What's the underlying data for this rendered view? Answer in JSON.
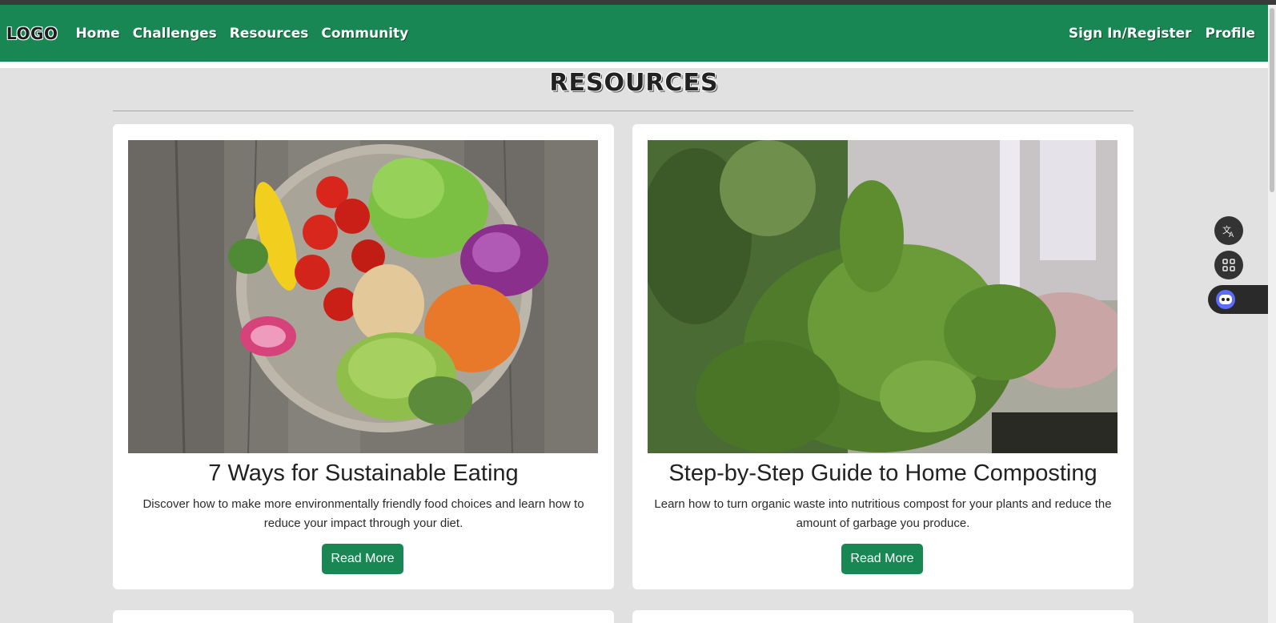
{
  "navbar": {
    "logo": "LOGO",
    "links": [
      "Home",
      "Challenges",
      "Resources",
      "Community"
    ],
    "right_links": [
      "Sign In/Register",
      "Profile"
    ]
  },
  "page": {
    "title": "RESOURCES"
  },
  "cards": [
    {
      "title": "7 Ways for Sustainable Eating",
      "description": "Discover how to make more environmentally friendly food choices and learn how to reduce your impact through your diet.",
      "button": "Read More"
    },
    {
      "title": "Step-by-Step Guide to Home Composting",
      "description": "Learn how to turn organic waste into nutritious compost for your plants and reduce the amount of garbage you produce.",
      "button": "Read More"
    }
  ],
  "floating_tools": [
    "translate-icon",
    "apps-grid-icon",
    "assistant-icon"
  ],
  "colors": {
    "brand": "#198754",
    "background": "#e1e1e1"
  }
}
